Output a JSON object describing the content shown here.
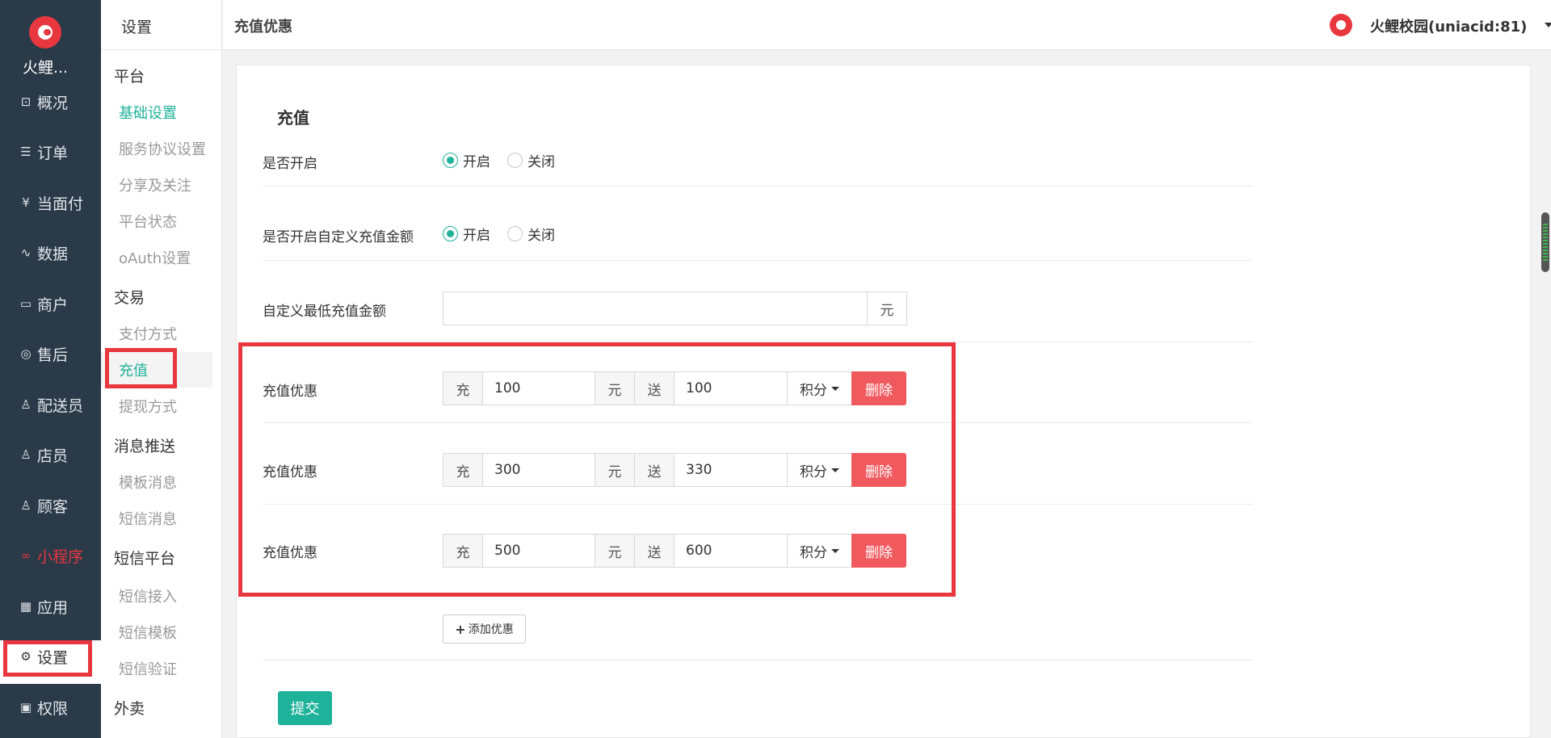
{
  "nav": {
    "brand": "火鲤...",
    "items": [
      {
        "label": "概况",
        "icon": "overview-icon",
        "glyph": "⊡"
      },
      {
        "label": "订单",
        "icon": "order-icon",
        "glyph": "☰"
      },
      {
        "label": "当面付",
        "icon": "yen-icon",
        "glyph": "¥"
      },
      {
        "label": "数据",
        "icon": "chart-icon",
        "glyph": "∿"
      },
      {
        "label": "商户",
        "icon": "store-icon",
        "glyph": "▭"
      },
      {
        "label": "售后",
        "icon": "headset-icon",
        "glyph": "◎"
      },
      {
        "label": "配送员",
        "icon": "courier-icon",
        "glyph": "♙"
      },
      {
        "label": "店员",
        "icon": "clerk-icon",
        "glyph": "♙"
      },
      {
        "label": "顾客",
        "icon": "customer-icon",
        "glyph": "♙"
      },
      {
        "label": "小程序",
        "icon": "miniapp-icon",
        "glyph": "∞"
      },
      {
        "label": "应用",
        "icon": "apps-icon",
        "glyph": "▦"
      },
      {
        "label": "设置",
        "icon": "gear-icon",
        "glyph": "⚙"
      },
      {
        "label": "权限",
        "icon": "lock-icon",
        "glyph": "▣"
      }
    ]
  },
  "subnav": {
    "title": "设置",
    "groups": {
      "platform": "平台",
      "trade": "交易",
      "message": "消息推送",
      "sms": "短信平台",
      "takeout": "外卖"
    },
    "items": {
      "basic": "基础设置",
      "agreement": "服务协议设置",
      "share": "分享及关注",
      "status": "平台状态",
      "oauth": "oAuth设置",
      "pay": "支付方式",
      "recharge": "充值",
      "withdraw": "提现方式",
      "template": "模板消息",
      "sms_msg": "短信消息",
      "sms_access": "短信接入",
      "sms_template": "短信模板",
      "sms_verify": "短信验证"
    }
  },
  "topbar": {
    "title": "充值优惠",
    "user": "火鲤校园(uniacid:81)"
  },
  "form": {
    "section_title": "充值",
    "enable_label": "是否开启",
    "custom_label": "是否开启自定义充值金额",
    "on": "开启",
    "off": "关闭",
    "min_label": "自定义最低充值金额",
    "min_value": "",
    "min_unit": "元",
    "promo_label": "充值优惠",
    "charge": "充",
    "yuan": "元",
    "give": "送",
    "points": "积分",
    "delete": "删除",
    "promos": [
      {
        "charge": "100",
        "give": "100"
      },
      {
        "charge": "300",
        "give": "330"
      },
      {
        "charge": "500",
        "give": "600"
      }
    ],
    "add_label": "添加优惠",
    "submit": "提交"
  }
}
